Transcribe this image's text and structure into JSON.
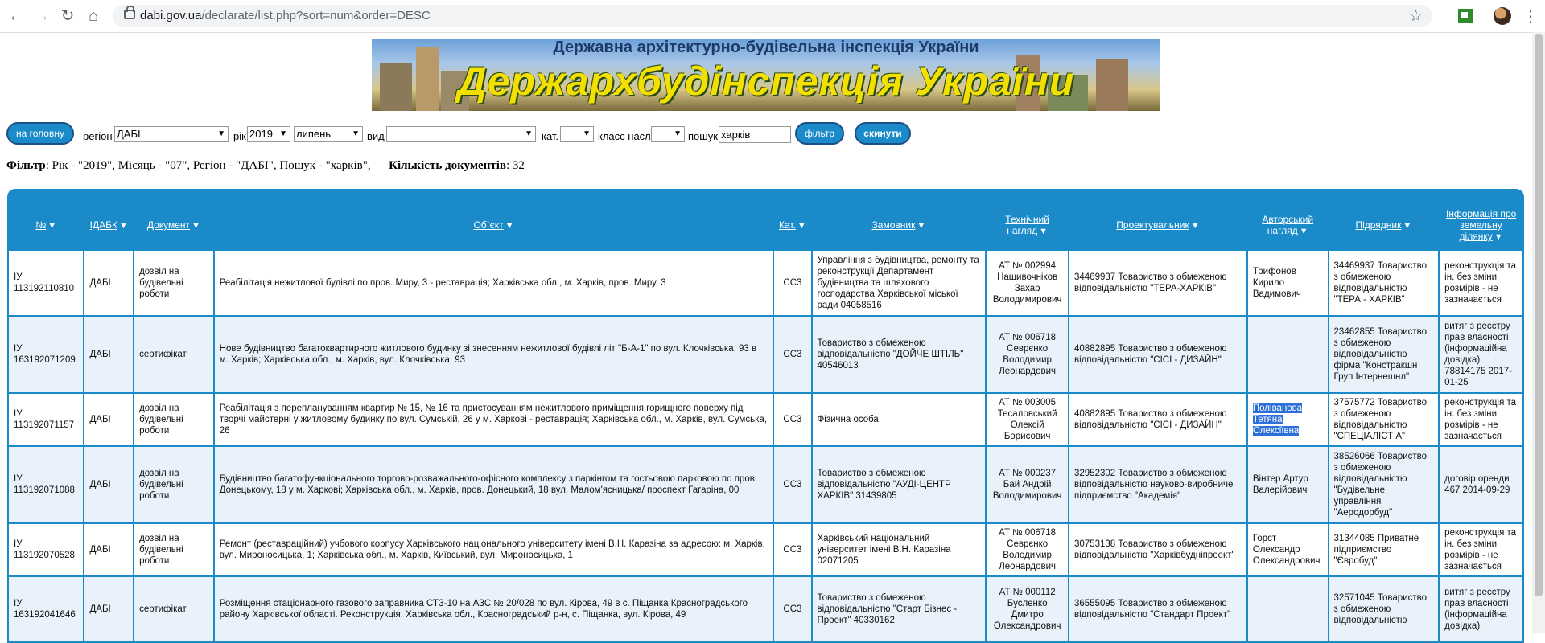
{
  "browser": {
    "url_domain": "dabi.gov.ua",
    "url_path": "/declarate/list.php?sort=num&order=DESC"
  },
  "banner": {
    "line1": "Державна архітектурно-будівельна інспекція України",
    "line2": "Держархбудінспекція України"
  },
  "filters": {
    "home_button": "на головну",
    "region_label": "регіон",
    "region_value": "ДАБІ",
    "year_label": "рік",
    "year_value": "2019",
    "month_value": "липень",
    "type_label": "вид",
    "type_value": "",
    "cat_label": "кат.",
    "cat_value": "",
    "class_label": "класс насл.",
    "class_value": "",
    "search_label": "пошук",
    "search_value": "харків",
    "filter_button": "фільтр",
    "reset_button": "скинути"
  },
  "summary": {
    "filter_label": "Фільтр",
    "filter_text": ": Рік - \"2019\", Місяць - \"07\", Регіон - \"ДАБІ\", Пошук - \"харків\",",
    "count_label": "Кількість документів",
    "count_value": ": 32"
  },
  "table": {
    "headers": [
      "№",
      "ІДАБК",
      "Документ",
      "Об`єкт",
      "Кат.",
      "Замовник",
      "Технічний нагляд",
      "Проектувальник",
      "Авторський нагляд",
      "Підрядник",
      "Інформація про земельну ділянку"
    ],
    "sort_arrow": "▼",
    "rows": [
      [
        "ІУ 113192110810",
        "ДАБІ",
        "дозвіл на будівельні роботи",
        "Реабілітація нежитлової будівлі по пров. Миру, 3 - реставрація; Харківська обл., м. Харків, пров. Миру, 3",
        "СС3",
        "Управління з будівництва, ремонту та реконструкції Департамент будівництва та шляхового господарства Харківської міської ради 04058516",
        "АТ № 002994 Нашивочніков Захар Володимирович",
        "34469937 Товариство з обмеженою відповідальністю \"ТЕРА-ХАРКІВ\"",
        "Трифонов Кирило Вадимович",
        "34469937 Товариство з обмеженою відповідальністю \"ТЕРА - ХАРКІВ\"",
        "реконструкція та ін. без зміни розмірів - не зазначається"
      ],
      [
        "ІУ 163192071209",
        "ДАБІ",
        "сертифікат",
        "Нове будівництво багатоквартирного житлового будинку зі знесенням нежитлової будівлі літ \"Б-А-1\" по вул. Клочківська, 93 в м. Харків; Харківська обл., м. Харків, вул. Клочківська, 93",
        "СС3",
        "Товариство з обмеженою відповідальністю \"ДОЙЧЕ ШТІЛЬ\" 40546013",
        "АТ № 006718 Севрєнко Володимир Леонардович",
        "40882895 Товариство з обмеженою відповідальністю \"СІСІ - ДИЗАЙН\"",
        "",
        "23462855 Товариство з обмеженою відповідальністю фірма \"Констракшн Груп Інтернешнл\"",
        "витяг з реєстру прав власності (інформаційна довідка) 78814175 2017-01-25"
      ],
      [
        "ІУ 113192071157",
        "ДАБІ",
        "дозвіл на будівельні роботи",
        "Реабілітація з переплануванням квартир № 15, № 16 та пристосуванням нежитлового приміщення горищного поверху під творчі майстерні у житловому будинку по вул. Сумській, 26 у м. Харкові - реставрація; Харківська обл., м. Харків, вул. Сумська, 26",
        "СС3",
        "Фізична особа",
        "АТ № 003005 Тесаловський Олексій Борисович",
        "40882895 Товариство з обмеженою відповідальністю \"СІСІ - ДИЗАЙН\"",
        "Поліванова Тетяна Олексіївна",
        "37575772 Товариство з обмеженою відповідальністю \"СПЕЦІАЛІСТ А\"",
        "реконструкція та ін. без зміни розмірів - не зазначається"
      ],
      [
        "ІУ 113192071088",
        "ДАБІ",
        "дозвіл на будівельні роботи",
        "Будівництво багатофункціонального торгово-розважального-офісного комплексу з паркінгом та гостьовою парковою по пров. Донецькому, 18 у м. Харкові; Харківська обл., м. Харків, пров. Донецький, 18 вул. Малом'ясницька/ проспект Гагаріна, 00",
        "СС3",
        "Товариство з обмеженою відповідальністю \"АУДІ-ЦЕНТР ХАРКІВ\" 31439805",
        "АТ № 000237 Бай Андрій Володимирович",
        "32952302 Товариство з обмеженою відповідальністю науково-виробниче підприємство \"Академія\"",
        "Вінтер Артур Валерійович",
        "38526066 Товариство з обмеженою відповідальністю \"Будівельне управління \"Аеродорбуд\"",
        "договір оренди 467 2014-09-29"
      ],
      [
        "ІУ 113192070528",
        "ДАБІ",
        "дозвіл на будівельні роботи",
        "Ремонт (реставраційний) учбового корпусу Харківського національного університету імені В.Н. Каразіна за адресою: м. Харків, вул. Мироносицька, 1; Харківська обл., м. Харків, Київський, вул. Мироносицька, 1",
        "СС3",
        "Харківський національний університет імені В.Н. Каразіна 02071205",
        "АТ № 006718 Севрєнко Володимир Леонардович",
        "30753138 Товариство з обмеженою відповідальністю \"Харківбудніпроект\"",
        "Горст Олександр Олександрович",
        "31344085 Приватне підприємство \"Євробуд\"",
        "реконструкція та ін. без зміни розмірів - не зазначається"
      ],
      [
        "ІУ 163192041646",
        "ДАБІ",
        "сертифікат",
        "Розміщення стаціонарного газового заправника СТЗ-10 на АЗС № 20/028 по вул. Кірова, 49 в с. Піщанка Красноградського району Харківської області. Реконструкція; Харківська обл., Красноградський р-н, с. Піщанка, вул. Кірова, 49",
        "СС3",
        "Товариство з обмеженою відповідальністю \"Старт Бізнес - Проект\" 40330162",
        "АТ № 000112 Бусленко Дмитро Олександрович",
        "36555095 Товариство з обмеженою відповідальністю \"Стандарт Проект\"",
        "",
        "32571045 Товариство з обмеженою відповідальністю",
        "витяг з реєстру прав власності (інформаційна довідка)"
      ]
    ]
  }
}
